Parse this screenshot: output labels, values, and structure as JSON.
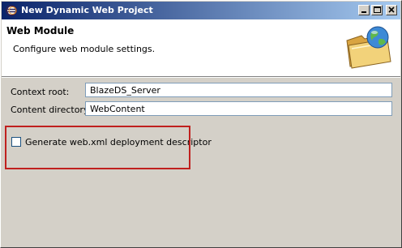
{
  "window": {
    "title": "New Dynamic Web Project",
    "icon": "eclipse-icon",
    "controls": {
      "minimize": "minimize-icon",
      "maximize": "maximize-icon",
      "close": "close-icon"
    }
  },
  "banner": {
    "title": "Web Module",
    "description": "Configure web module settings.",
    "image": "folder-globe-icon"
  },
  "form": {
    "context_root_label": "Context root:",
    "context_root_value": "BlazeDS_Server",
    "content_dir_label": "Content directory:",
    "content_dir_value": "WebContent",
    "generate_xml_label": "Generate web.xml deployment descriptor",
    "generate_xml_checked": false
  },
  "colors": {
    "titlebar_start": "#0a246a",
    "titlebar_end": "#a6caf0",
    "highlight_border": "#c0201e",
    "dialog_bg": "#d4d0c8"
  }
}
